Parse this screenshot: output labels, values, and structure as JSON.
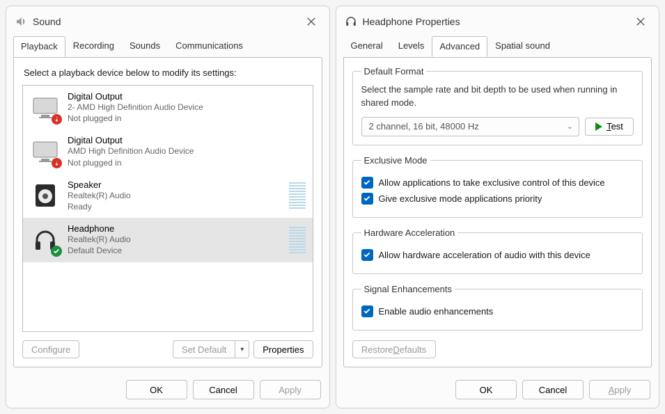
{
  "sound": {
    "title": "Sound",
    "tabs": [
      "Playback",
      "Recording",
      "Sounds",
      "Communications"
    ],
    "active_tab": 0,
    "instruction": "Select a playback device below to modify its settings:",
    "devices": [
      {
        "name": "Digital Output",
        "desc": "2- AMD High Definition Audio Device",
        "state": "Not plugged in",
        "plugged": false,
        "has_meter": false,
        "selected": false,
        "kind": "monitor"
      },
      {
        "name": "Digital Output",
        "desc": "AMD High Definition Audio Device",
        "state": "Not plugged in",
        "plugged": false,
        "has_meter": false,
        "selected": false,
        "kind": "monitor"
      },
      {
        "name": "Speaker",
        "desc": "Realtek(R) Audio",
        "state": "Ready",
        "plugged": true,
        "has_meter": true,
        "selected": false,
        "kind": "speaker"
      },
      {
        "name": "Headphone",
        "desc": "Realtek(R) Audio",
        "state": "Default Device",
        "plugged": true,
        "has_meter": true,
        "selected": true,
        "kind": "headphone"
      }
    ],
    "configure_label": "Configure",
    "set_default_label": "Set Default",
    "properties_label": "Properties",
    "ok_label": "OK",
    "cancel_label": "Cancel",
    "apply_label": "Apply"
  },
  "props": {
    "title": "Headphone Properties",
    "tabs": [
      "General",
      "Levels",
      "Advanced",
      "Spatial sound"
    ],
    "active_tab": 2,
    "default_format": {
      "legend": "Default Format",
      "desc": "Select the sample rate and bit depth to be used when running in shared mode.",
      "value": "2 channel, 16 bit, 48000 Hz",
      "test_label": "Test"
    },
    "exclusive_mode": {
      "legend": "Exclusive Mode",
      "opt1": "Allow applications to take exclusive control of this device",
      "opt2": "Give exclusive mode applications priority"
    },
    "hw_accel": {
      "legend": "Hardware Acceleration",
      "opt": "Allow hardware acceleration of audio with this device"
    },
    "signal_enh": {
      "legend": "Signal Enhancements",
      "opt": "Enable audio enhancements"
    },
    "restore_label": "Restore Defaults",
    "ok_label": "OK",
    "cancel_label": "Cancel",
    "apply_label": "Apply"
  }
}
